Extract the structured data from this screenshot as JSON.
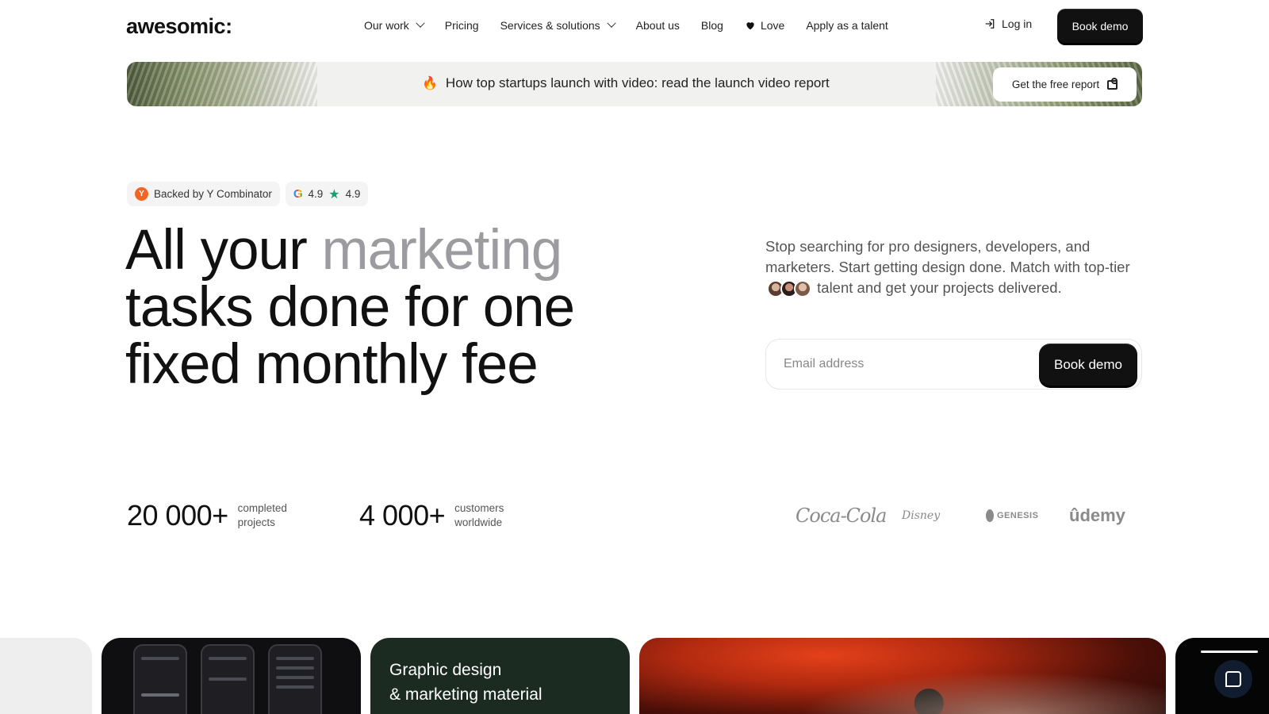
{
  "nav": {
    "logo": "awesomic:",
    "items": [
      {
        "label": "Our work",
        "dropdown": true
      },
      {
        "label": "Pricing",
        "dropdown": false
      },
      {
        "label": "Services & solutions",
        "dropdown": true
      },
      {
        "label": "About us",
        "dropdown": false
      },
      {
        "label": "Blog",
        "dropdown": false
      },
      {
        "label": "Love",
        "dropdown": false,
        "icon": "heart-icon"
      },
      {
        "label": "Apply as a talent",
        "dropdown": false
      }
    ],
    "login_label": "Log in",
    "cta_label": "Book demo"
  },
  "banner": {
    "emoji": "🔥",
    "text": "How top startups launch with video: read the launch video report",
    "button_label": "Get the free report"
  },
  "badges": {
    "yc_letter": "Y",
    "yc_label": "Backed by Y Combinator",
    "google_letter": "G",
    "google_rating": "4.9",
    "trustpilot_rating": "4.9"
  },
  "hero": {
    "title_part1": "All your ",
    "title_muted": "marketing",
    "title_line2": "tasks done for one",
    "title_line3": "fixed monthly fee",
    "desc_before": "Stop searching for pro designers, developers, and marketers. Start getting design done. Match with top-tier",
    "desc_after": "talent and get your projects delivered.",
    "email_placeholder": "Email address",
    "form_cta_label": "Book demo"
  },
  "stats": [
    {
      "value": "20 000+",
      "label": "completed projects"
    },
    {
      "value": "4 000+",
      "label": "customers worldwide"
    }
  ],
  "client_logos": [
    "Coca-Cola",
    "Disney",
    "GENESIS",
    "ûdemy"
  ],
  "cards": {
    "green_title_line1": "Graphic design",
    "green_title_line2": "& marketing material"
  },
  "colors": {
    "accent_dark": "#111111",
    "muted_text": "#9b9ba0",
    "yc_orange": "#f26522",
    "trust_green": "#1aa06d",
    "card_green": "#1c2b22"
  }
}
